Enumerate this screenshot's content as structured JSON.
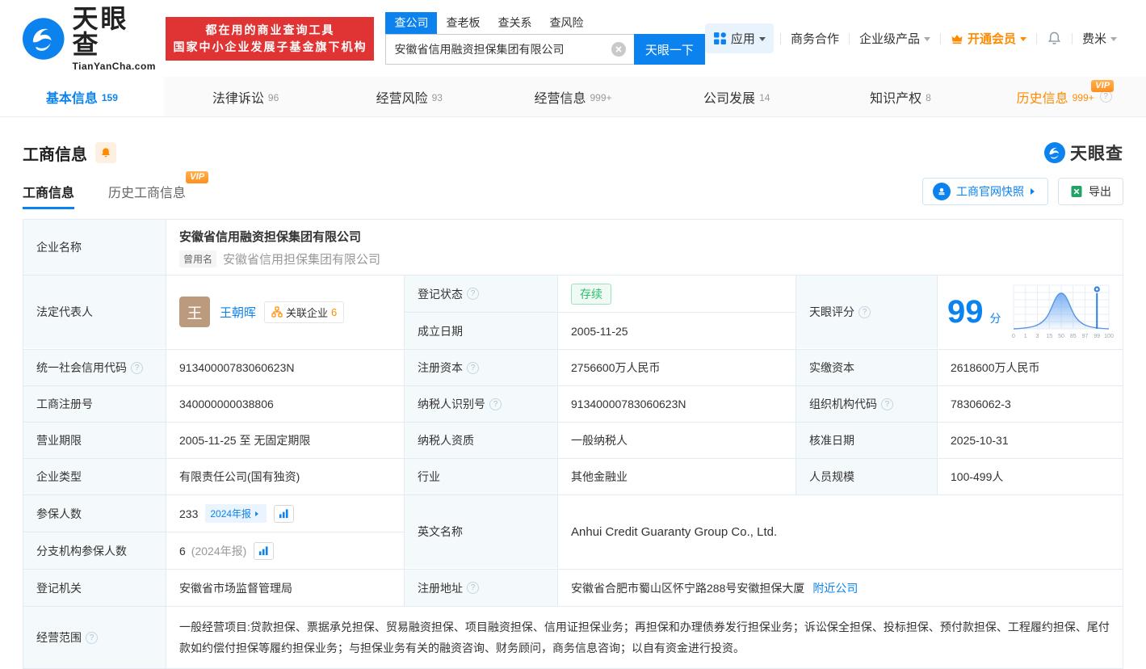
{
  "colors": {
    "accent": "#0b82ee",
    "orange": "#ff8a00",
    "red": "#e03434",
    "green": "#2fbf6b"
  },
  "header": {
    "logo_title": "天眼查",
    "logo_domain": "TianYanCha.com",
    "banner_line1": "都在用的商业查询工具",
    "banner_line2": "国家中小企业发展子基金旗下机构",
    "search_tabs": [
      {
        "label": "查公司"
      },
      {
        "label": "查老板"
      },
      {
        "label": "查关系"
      },
      {
        "label": "查风险"
      }
    ],
    "search_value": "安徽省信用融资担保集团有限公司",
    "search_button": "天眼一下",
    "nav_apps": "应用",
    "nav_cooperation": "商务合作",
    "nav_enterprise": "企业级产品",
    "nav_vip": "开通会员",
    "nav_user": "费米"
  },
  "tabs": [
    {
      "label": "基本信息",
      "count": "159"
    },
    {
      "label": "法律诉讼",
      "count": "96"
    },
    {
      "label": "经营风险",
      "count": "93"
    },
    {
      "label": "经营信息",
      "count": "999+"
    },
    {
      "label": "公司发展",
      "count": "14"
    },
    {
      "label": "知识产权",
      "count": "8"
    },
    {
      "label": "历史信息",
      "count": "999+",
      "vip": "VIP"
    }
  ],
  "section": {
    "title": "工商信息",
    "brand": "天眼查",
    "subtab_active": "工商信息",
    "subtab_history": "历史工商信息",
    "vip_badge": "VIP",
    "snapshot_button": "工商官网快照",
    "export_button": "导出"
  },
  "table": {
    "name_label": "企业名称",
    "name": "安徽省信用融资担保集团有限公司",
    "former_label": "曾用名",
    "former_name": "安徽省信用担保集团有限公司",
    "legal_label": "法定代表人",
    "legal_avatar": "王",
    "legal_name": "王朝晖",
    "related_label": "关联企业",
    "related_count": "6",
    "status_label": "登记状态",
    "status": "存续",
    "established_label": "成立日期",
    "established": "2005-11-25",
    "score_label": "天眼评分",
    "score": "99",
    "score_unit": "分",
    "credit_code_label": "统一社会信用代码",
    "credit_code": "91340000783060623N",
    "reg_capital_label": "注册资本",
    "reg_capital": "2756600万人民币",
    "paid_capital_label": "实缴资本",
    "paid_capital": "2618600万人民币",
    "reg_no_label": "工商注册号",
    "reg_no": "340000000038806",
    "taxpayer_id_label": "纳税人识别号",
    "taxpayer_id": "91340000783060623N",
    "org_code_label": "组织机构代码",
    "org_code": "78306062-3",
    "term_label": "营业期限",
    "term": "2005-11-25 至 无固定期限",
    "taxpayer_quality_label": "纳税人资质",
    "taxpayer_quality": "一般纳税人",
    "approval_date_label": "核准日期",
    "approval_date": "2025-10-31",
    "company_type_label": "企业类型",
    "company_type": "有限责任公司(国有独资)",
    "industry_label": "行业",
    "industry": "其他金融业",
    "staff_label": "人员规模",
    "staff": "100-499人",
    "insured_label": "参保人数",
    "insured": "233",
    "insured_badge": "2024年报",
    "branch_insured_label": "分支机构参保人数",
    "branch_insured": "6",
    "branch_insured_note": "(2024年报)",
    "english_label": "英文名称",
    "english_name": "Anhui Credit Guaranty Group Co., Ltd.",
    "registry_label": "登记机关",
    "registry": "安徽省市场监督管理局",
    "address_label": "注册地址",
    "address": "安徽省合肥市蜀山区怀宁路288号安徽担保大厦",
    "nearby_link": "附近公司",
    "scope_label": "经营范围",
    "scope": "一般经营项目:贷款担保、票据承兑担保、贸易融资担保、项目融资担保、信用证担保业务；再担保和办理债券发行担保业务；诉讼保全担保、投标担保、预付款担保、工程履约担保、尾付款如约偿付担保等履约担保业务；与担保业务有关的融资咨询、财务顾问，商务信息咨询；以自有资金进行投资。"
  },
  "score_chart": {
    "type": "area",
    "description": "score-distribution-bell-curve",
    "ticks": [
      "0",
      "1",
      "3",
      "15",
      "50",
      "85",
      "97",
      "99",
      "100"
    ],
    "marker_value": 99
  }
}
